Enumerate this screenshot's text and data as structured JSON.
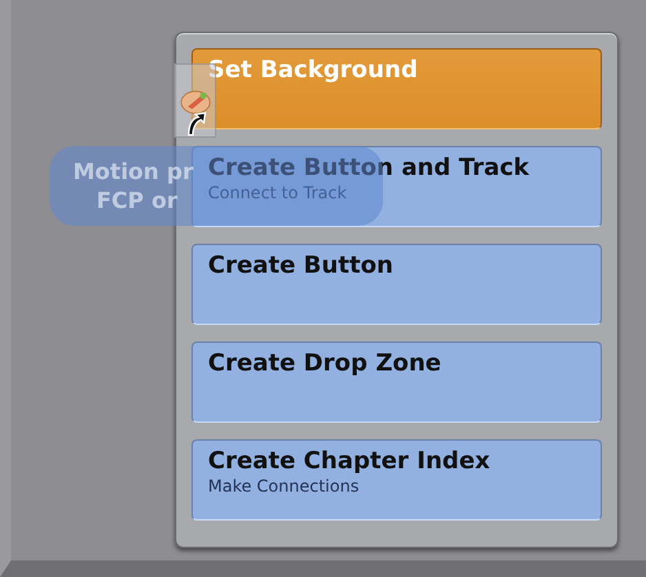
{
  "drop_palette": {
    "items": [
      {
        "title": "Set Background",
        "selected": true
      },
      {
        "title": "Create Button and Track",
        "subtitle": "Connect to Track",
        "selected": false
      },
      {
        "title": "Create Button",
        "selected": false
      },
      {
        "title": "Create Drop Zone",
        "selected": false
      },
      {
        "title": "Create Chapter Index",
        "subtitle": "Make Connections",
        "selected": false
      }
    ]
  },
  "drag_item": {
    "label_lines": [
      "Motion pr",
      "FCP or"
    ]
  }
}
